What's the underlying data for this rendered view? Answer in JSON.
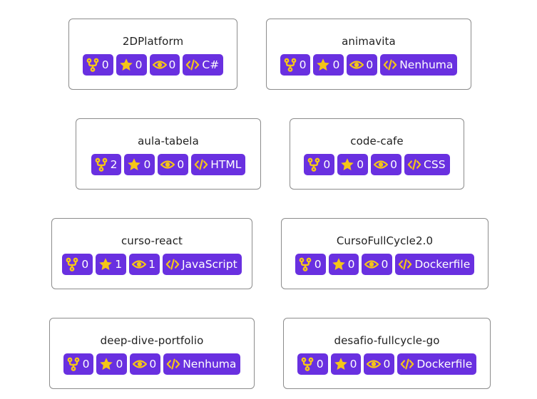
{
  "colors": {
    "badge_bg": "#6930e0",
    "icon_accent": "#f5c518",
    "card_border": "#8c8c8c"
  },
  "icons": [
    "fork-icon",
    "star-icon",
    "eye-icon",
    "code-icon"
  ],
  "repos": [
    {
      "name": "2DPlatform",
      "forks": "0",
      "stars": "0",
      "watchers": "0",
      "language": "C#"
    },
    {
      "name": "animavita",
      "forks": "0",
      "stars": "0",
      "watchers": "0",
      "language": "Nenhuma"
    },
    {
      "name": "aula-tabela",
      "forks": "2",
      "stars": "0",
      "watchers": "0",
      "language": "HTML"
    },
    {
      "name": "code-cafe",
      "forks": "0",
      "stars": "0",
      "watchers": "0",
      "language": "CSS"
    },
    {
      "name": "curso-react",
      "forks": "0",
      "stars": "1",
      "watchers": "1",
      "language": "JavaScript"
    },
    {
      "name": "CursoFullCycle2.0",
      "forks": "0",
      "stars": "0",
      "watchers": "0",
      "language": "Dockerfile"
    },
    {
      "name": "deep-dive-portfolio",
      "forks": "0",
      "stars": "0",
      "watchers": "0",
      "language": "Nenhuma"
    },
    {
      "name": "desafio-fullcycle-go",
      "forks": "0",
      "stars": "0",
      "watchers": "0",
      "language": "Dockerfile"
    }
  ]
}
